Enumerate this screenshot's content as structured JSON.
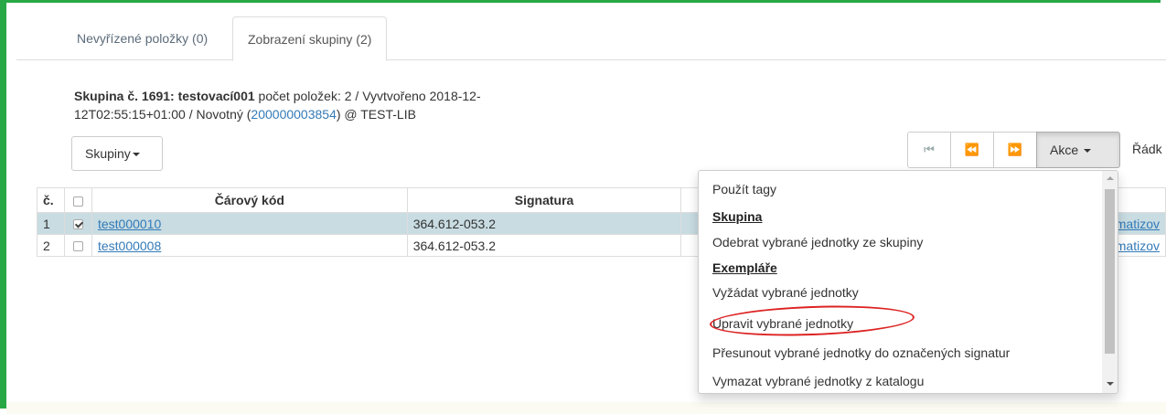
{
  "tabs": [
    {
      "label": "Nevyřízené položky (0)",
      "active": false
    },
    {
      "label": "Zobrazení skupiny (2)",
      "active": true
    }
  ],
  "group_info": {
    "title": "Skupina č. 1691: testovací001",
    "meta_before": " počet položek: 2 / Vyvtvořeno 2018-12-12T02:55:15+01:00 / Novotný (",
    "user_id": "200000003854",
    "meta_after": ") @ TEST-LIB"
  },
  "skupiny_button": "Skupiny",
  "pager": {
    "first": "⏮",
    "prev": "⏪",
    "next": "⏩"
  },
  "akce_button": "Akce",
  "radky_label": "Řádk",
  "table": {
    "headers": [
      "č.",
      "",
      "Čárový kód",
      "Signatura",
      ""
    ],
    "rows": [
      {
        "num": "1",
        "checked": true,
        "barcode": "test000010",
        "signature": "364.612-053.2",
        "trail": "matizov"
      },
      {
        "num": "2",
        "checked": false,
        "barcode": "test000008",
        "signature": "364.612-053.2",
        "trail": "matizov"
      }
    ]
  },
  "dropdown": {
    "use_tags": "Použít tagy",
    "group_header": "Skupina",
    "remove_from_group": "Odebrat vybrané jednotky ze skupiny",
    "items_header": "Exempláře",
    "request_items": "Vyžádat vybrané jednotky",
    "edit_items": "Upravit vybrané jednotky",
    "move_items": "Přesunout vybrané jednotky do označených signatur",
    "delete_items": "Vymazat vybrané jednotky z katalogu"
  },
  "colors": {
    "frame": "#27a844",
    "selected_row": "#c8dce2",
    "highlight_circle": "#dd2222",
    "link": "#337ab7"
  }
}
